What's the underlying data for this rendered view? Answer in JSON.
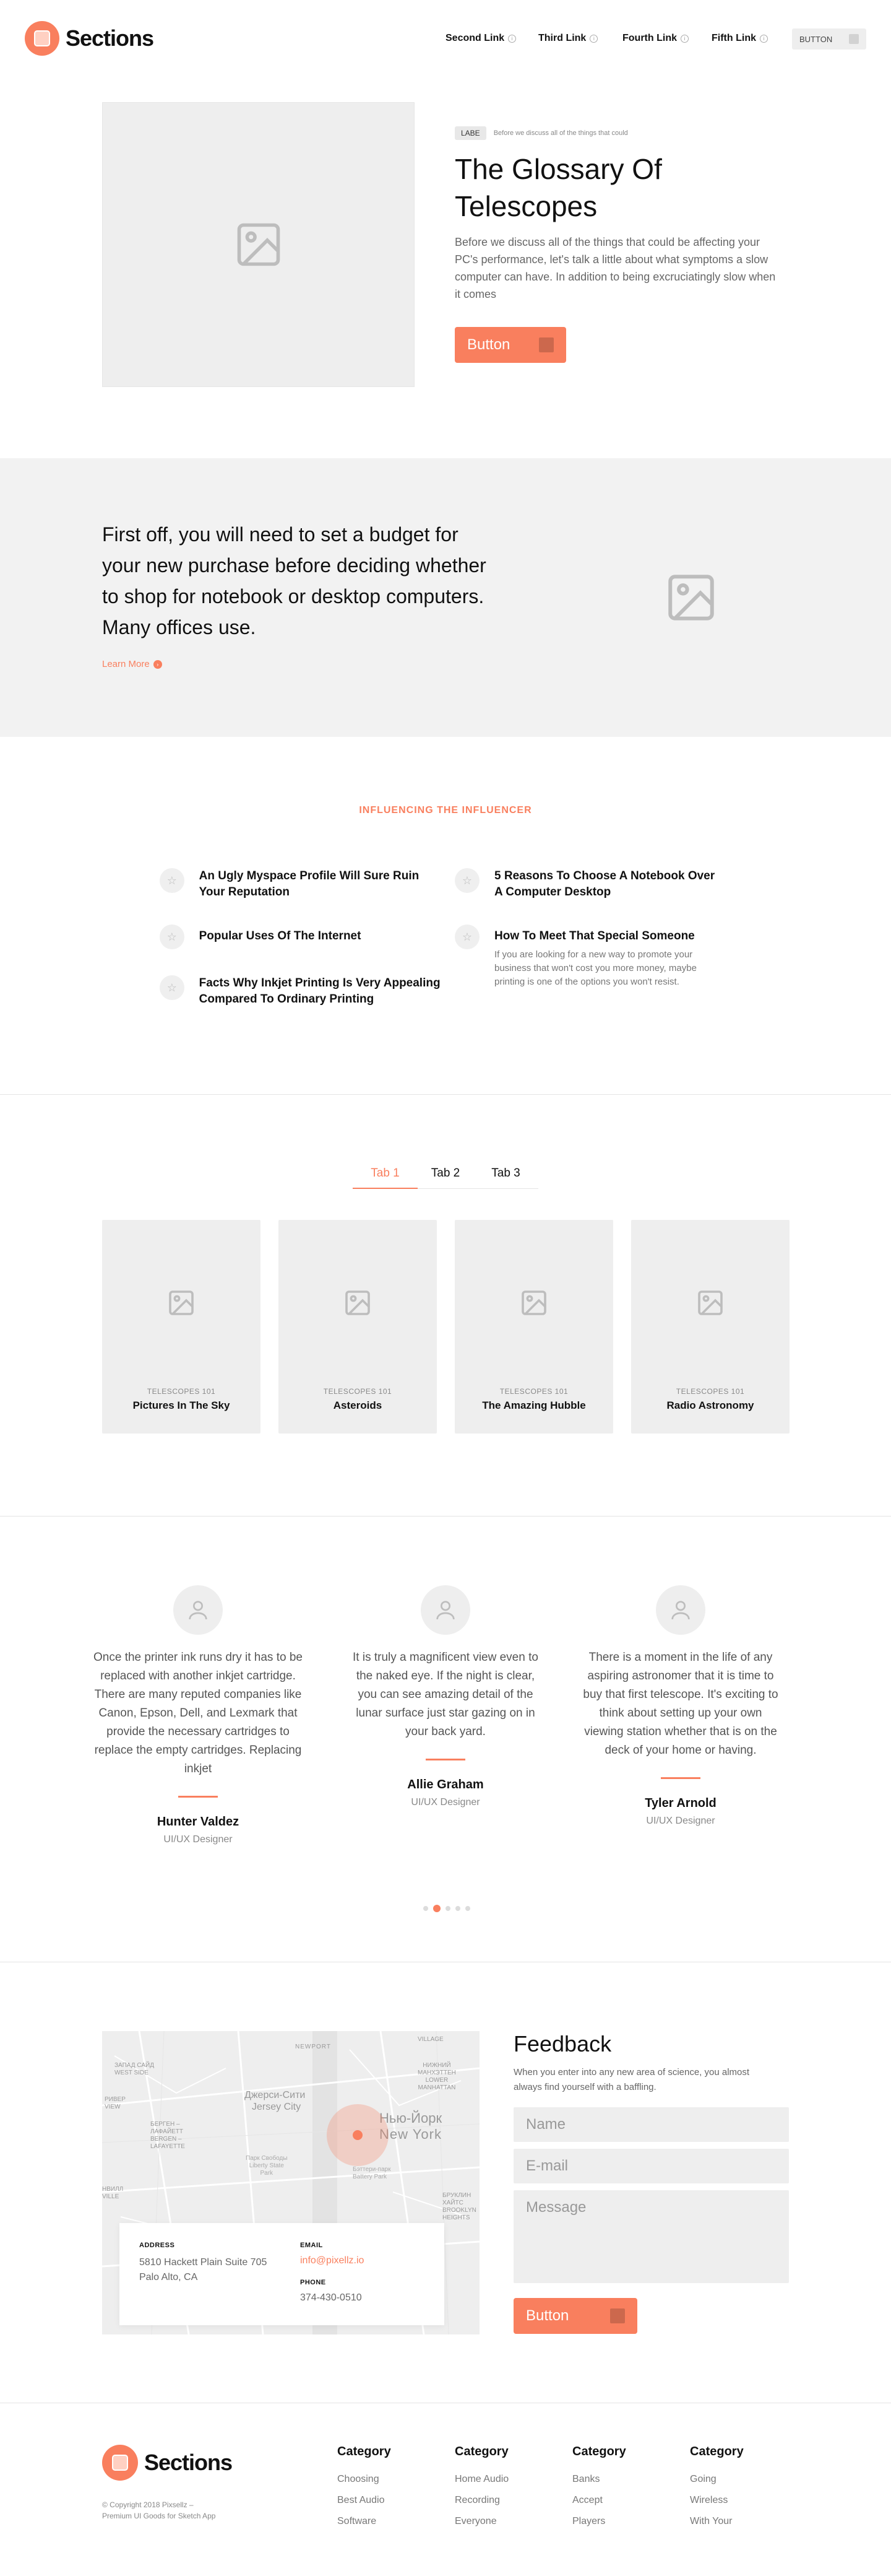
{
  "header": {
    "logo_text": "Sections",
    "nav": [
      "Second Link",
      "Third Link",
      "Fourth Link",
      "Fifth Link"
    ],
    "button": "BUTTON"
  },
  "hero": {
    "badge": "LABE",
    "badge_note": "Before we discuss all of the things that could",
    "title_line1": "The Glossary Of",
    "title_line2": "Telescopes",
    "body": "Before we discuss all of the things that could be affecting your PC's performance, let's talk a little about what symptoms a slow computer can have. In addition to being excruciatingly slow when it comes",
    "button": "Button"
  },
  "banner": {
    "text": "First off, you will need to set a budget for your new purchase before deciding whether to shop for notebook or desktop computers. Many offices use.",
    "link": "Learn More"
  },
  "features": {
    "eyebrow": "INFLUENCING THE INFLUENCER",
    "items": [
      {
        "title": "An Ugly Myspace Profile Will Sure Ruin Your Reputation"
      },
      {
        "title": "5 Reasons To Choose A Notebook Over A Computer Desktop"
      },
      {
        "title": "Popular Uses Of The Internet"
      },
      {
        "title": "How To Meet That Special Someone",
        "desc": "If you are looking for a new way to promote your business that won't cost you more money, maybe printing is one of the options you won't resist."
      },
      {
        "title": "Facts Why Inkjet Printing Is Very Appealing Compared To Ordinary Printing"
      }
    ]
  },
  "tabs": {
    "labels": [
      "Tab 1",
      "Tab 2",
      "Tab 3"
    ],
    "active": 0,
    "cards": [
      {
        "category": "TELESCOPES 101",
        "title": "Pictures In The Sky"
      },
      {
        "category": "TELESCOPES 101",
        "title": "Asteroids"
      },
      {
        "category": "TELESCOPES 101",
        "title": "The Amazing Hubble"
      },
      {
        "category": "TELESCOPES 101",
        "title": "Radio Astronomy"
      }
    ]
  },
  "testimonials": [
    {
      "quote": "Once the printer ink runs dry it has to be replaced with another inkjet cartridge. There are many reputed companies like Canon, Epson, Dell, and Lexmark that provide the necessary cartridges to replace the empty cartridges. Replacing inkjet",
      "name": "Hunter Valdez",
      "role": "UI/UX Designer"
    },
    {
      "quote": "It is truly a magnificent view even to the naked eye. If the night is clear, you can see amazing detail of the lunar surface just star gazing on in your back yard.",
      "name": "Allie Graham",
      "role": "UI/UX Designer"
    },
    {
      "quote": "There is a moment in the life of any aspiring astronomer that it is time to buy that first telescope. It's exciting to think about setting up your own viewing station whether that is on the deck of your home or having.",
      "name": "Tyler Arnold",
      "role": "UI/UX Designer"
    }
  ],
  "carousel": {
    "count": 5,
    "active": 1
  },
  "contact": {
    "map_labels": {
      "newport": "NEWPORT",
      "jersey_ru": "Джерси-Сити",
      "jersey": "Jersey City",
      "ny_ru": "Нью-Йорк",
      "ny": "New York",
      "lower_manhattan": "НИЖНИЙ\nМАНХЭТТЕН\nLOWER\nMANHATTAN",
      "west_side": "ЗАПАД САЙД\nWEST SIDE",
      "bergen": "БЕРГЕН –\nЛАФАЙЕТТ\nBERGEN –\nLAFAYETTE",
      "village": "VILLAGE",
      "liberty_park": "Парк Свободы\nLiberty State\nPark",
      "brooklyn": "БРУКЛИН\nХАЙТС\nBROOKLYN\nHEIGHTS",
      "battery": "Бэттери-парк\nBattery Park",
      "river": "РИВЕР\nVIEW",
      "ville": "НВИЛЛ\nVILLE"
    },
    "address_label": "ADDRESS",
    "address": "5810 Hackett Plain Suite 705 Palo Alto, CA",
    "email_label": "EMAIL",
    "email": "info@pixellz.io",
    "phone_label": "PHONE",
    "phone": "374-430-0510",
    "form_title": "Feedback",
    "form_desc": "When you enter into any new area of science, you almost always find yourself with a baffling.",
    "name_placeholder": "Name",
    "email_placeholder": "E-mail",
    "message_placeholder": "Message",
    "button": "Button"
  },
  "footer": {
    "logo_text": "Sections",
    "copyright_line1": "© Copyright 2018 Pixsellz –",
    "copyright_line2": "Premium UI Goods for Sketch App",
    "columns": [
      {
        "heading": "Category",
        "links": [
          "Choosing",
          "Best Audio",
          "Software"
        ]
      },
      {
        "heading": "Category",
        "links": [
          "Home Audio",
          "Recording",
          "Everyone"
        ]
      },
      {
        "heading": "Category",
        "links": [
          "Banks",
          "Accept",
          "Players"
        ]
      },
      {
        "heading": "Category",
        "links": [
          "Going",
          "Wireless",
          "With Your"
        ]
      }
    ]
  },
  "colors": {
    "accent": "#f97f5e",
    "placeholder_bg": "#eeeeee",
    "banner_bg": "#f2f2f2"
  }
}
